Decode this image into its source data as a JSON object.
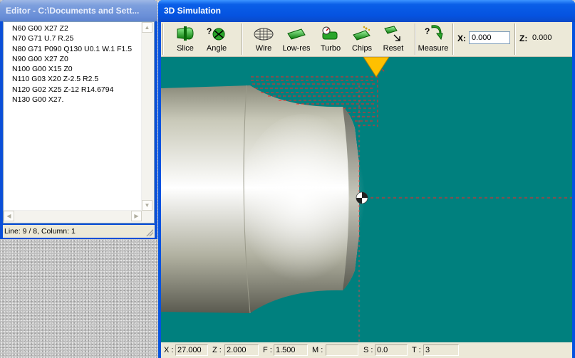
{
  "editor": {
    "title": "Editor - C:\\Documents and Sett...",
    "lines": [
      "N60 G00 X27 Z2",
      "N70 G71 U.7 R.25",
      "N80 G71 P090 Q130 U0.1 W.1 F1.5",
      "N90 G00 X27 Z0",
      "N100 G00 X15 Z0",
      "N110 G03 X20 Z-2.5 R2.5",
      "N120 G02 X25 Z-12 R14.6794",
      "N130 G00 X27."
    ],
    "status": "Line: 9 / 8, Column: 1"
  },
  "simulation": {
    "title": "3D Simulation",
    "tools": [
      {
        "label": "Slice",
        "icon": "slice-icon"
      },
      {
        "label": "Angle",
        "icon": "angle-icon"
      },
      {
        "label": "Wire",
        "icon": "wire-icon"
      },
      {
        "label": "Low-res",
        "icon": "low-res-icon"
      },
      {
        "label": "Turbo",
        "icon": "turbo-icon"
      },
      {
        "label": "Chips",
        "icon": "chips-icon"
      },
      {
        "label": "Reset",
        "icon": "reset-icon"
      },
      {
        "label": "Measure",
        "icon": "measure-icon"
      }
    ],
    "x_label": "X:",
    "x_value": "0.000",
    "z_label": "Z:",
    "z_value": "0.000"
  },
  "status": {
    "x_label": "X :",
    "x_value": "27.000",
    "z_label": "Z :",
    "z_value": "2.000",
    "f_label": "F :",
    "f_value": "1.500",
    "m_label": "M :",
    "m_value": "",
    "s_label": "S :",
    "s_value": "0.0",
    "t_label": "T :",
    "t_value": "3"
  },
  "colors": {
    "viewport_bg": "#00807e",
    "toolpath": "#ff2020",
    "tool_insert": "#ffc000",
    "title_active": "#0553e0"
  }
}
